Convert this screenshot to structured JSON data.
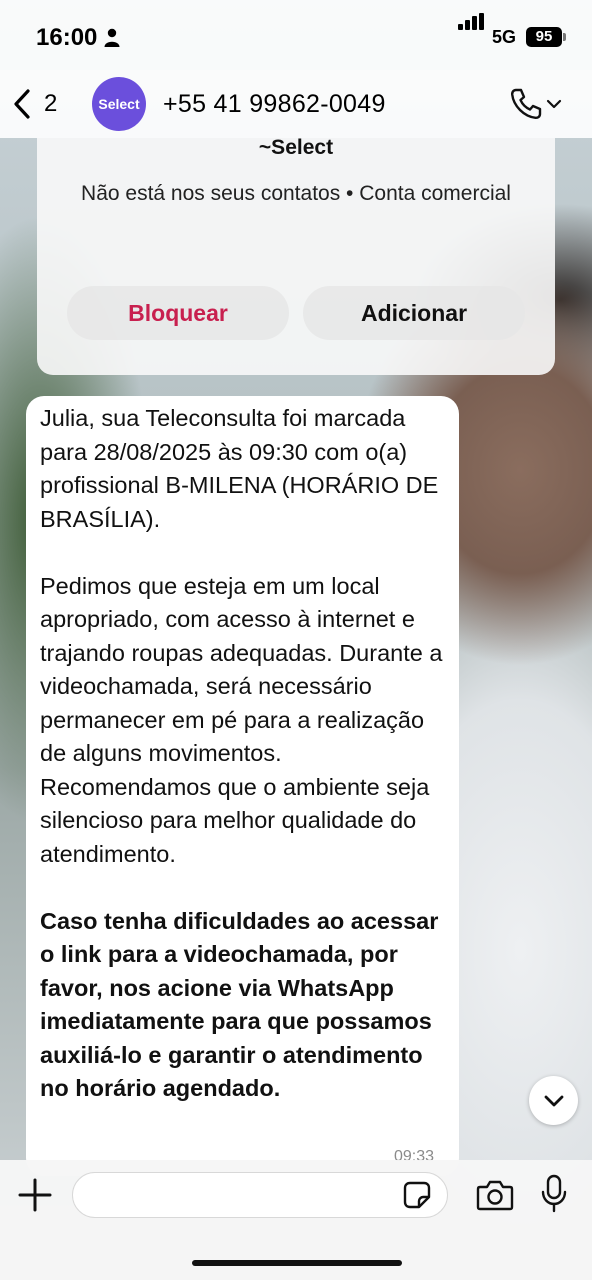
{
  "status_bar": {
    "time": "16:00",
    "network": "5G",
    "battery": "95"
  },
  "header": {
    "back_count": "2",
    "avatar_text": "Select",
    "contact_number": "+55 41 99862-0049"
  },
  "contact_card": {
    "name": "~Select",
    "info": "Não está nos seus contatos • Conta comercial",
    "block_label": "Bloquear",
    "add_label": "Adicionar",
    "block_color": "#c8204f"
  },
  "message": {
    "paragraph_1": "Julia, sua Teleconsulta foi marcada para 28/08/2025 às 09:30 com o(a) profissional B-MILENA (HORÁRIO DE BRASÍLIA).",
    "paragraph_2": "Pedimos que esteja em um local apropriado, com acesso à internet e trajando roupas adequadas. Durante a videochamada, será necessário permanecer em pé para a realização de alguns movimentos. Recomendamos que o ambiente seja silencioso para melhor qualidade do atendimento.",
    "paragraph_3_bold": "Caso tenha dificuldades ao acessar o link para a videochamada, por favor, nos acione via WhatsApp imediatamente para que possamos auxiliá-lo e garantir o atendimento no horário agendado.",
    "time": "09:33"
  },
  "input_bar": {
    "placeholder": ""
  },
  "icons": {
    "back": "chevron-left-icon",
    "call": "phone-icon",
    "call_menu": "chevron-down-icon",
    "scroll": "chevron-down-icon",
    "attach": "plus-icon",
    "sticker": "sticker-icon",
    "camera": "camera-icon",
    "mic": "microphone-icon"
  }
}
